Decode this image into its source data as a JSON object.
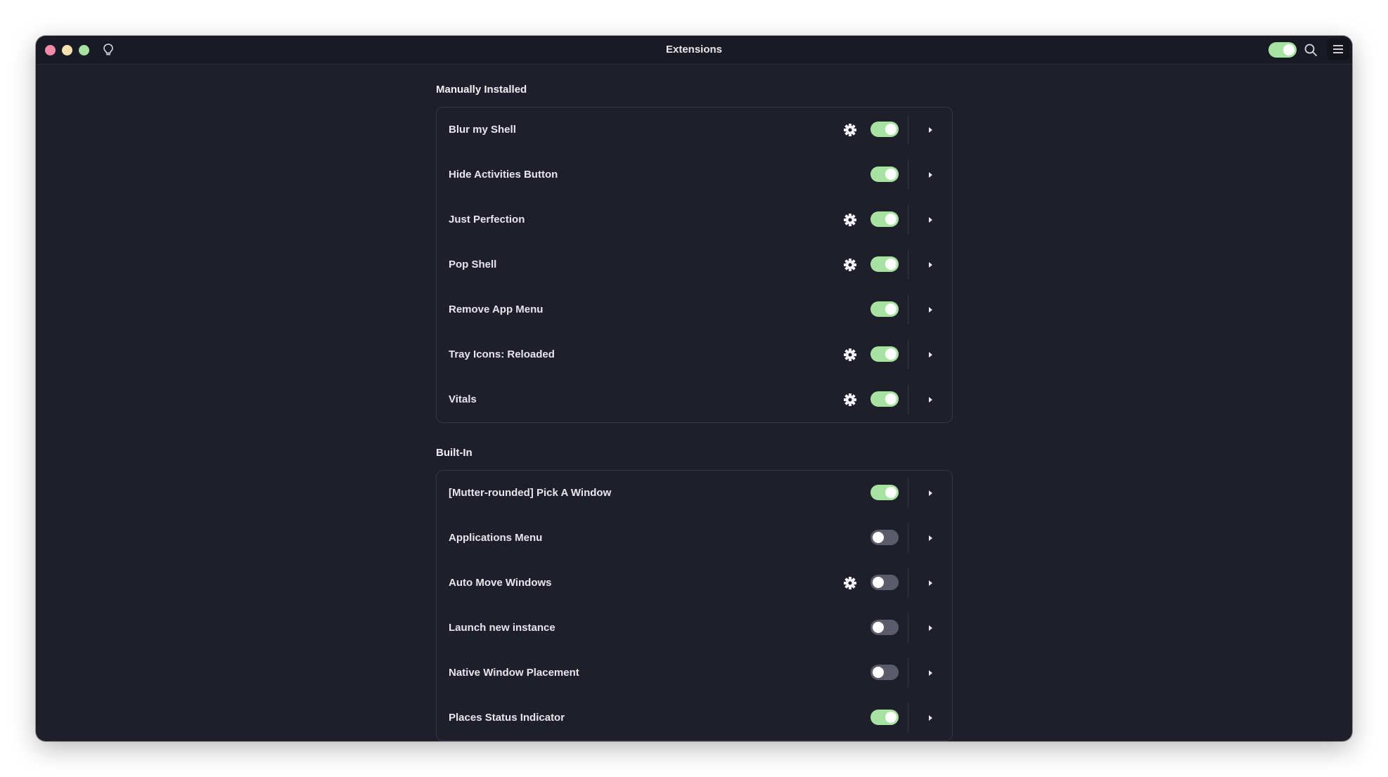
{
  "window": {
    "title": "Extensions",
    "header_toggle_on": true
  },
  "colors": {
    "window_bg": "#1f1f2b",
    "titlebar_bg": "#1a1a25",
    "accent_green": "#a6e3a1",
    "close": "#f38ba8",
    "minimize": "#f9e2af",
    "maximize": "#a6e3a1",
    "toggle_off": "#5b5b6a"
  },
  "icons": {
    "titlebar": [
      "lightbulb-icon",
      "search-icon",
      "hamburger-menu-icon"
    ],
    "row": [
      "gear-icon",
      "chevron-right-icon"
    ]
  },
  "sections": [
    {
      "title": "Manually Installed",
      "items": [
        {
          "label": "Blur my Shell",
          "settings": true,
          "enabled": true
        },
        {
          "label": "Hide Activities Button",
          "settings": false,
          "enabled": true
        },
        {
          "label": "Just Perfection",
          "settings": true,
          "enabled": true
        },
        {
          "label": "Pop Shell",
          "settings": true,
          "enabled": true
        },
        {
          "label": "Remove App Menu",
          "settings": false,
          "enabled": true
        },
        {
          "label": "Tray Icons: Reloaded",
          "settings": true,
          "enabled": true
        },
        {
          "label": "Vitals",
          "settings": true,
          "enabled": true
        }
      ]
    },
    {
      "title": "Built-In",
      "items": [
        {
          "label": "[Mutter-rounded] Pick A Window",
          "settings": false,
          "enabled": true
        },
        {
          "label": "Applications Menu",
          "settings": false,
          "enabled": false
        },
        {
          "label": "Auto Move Windows",
          "settings": true,
          "enabled": false
        },
        {
          "label": "Launch new instance",
          "settings": false,
          "enabled": false
        },
        {
          "label": "Native Window Placement",
          "settings": false,
          "enabled": false
        },
        {
          "label": "Places Status Indicator",
          "settings": false,
          "enabled": true
        }
      ]
    }
  ]
}
